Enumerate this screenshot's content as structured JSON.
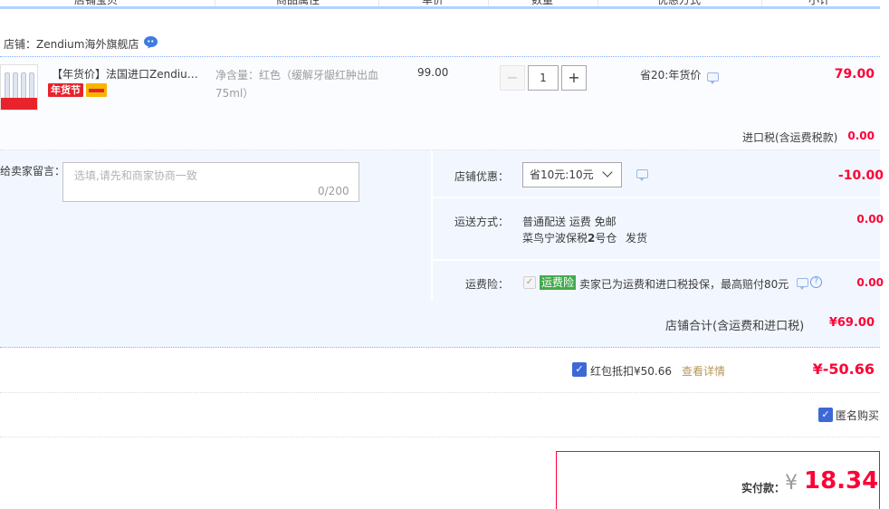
{
  "header": {
    "columns": [
      "店铺宝贝",
      "商品属性",
      "单价",
      "数量",
      "优惠方式",
      "小计"
    ]
  },
  "store": {
    "name_label": "店铺：Zendium海外旗舰店"
  },
  "item": {
    "title": "【年货价】法国进口Zendium...",
    "badge": "年货节",
    "attr": "净含量：红色（缓解牙龈红肿出血75ml）",
    "price": "99.00",
    "quantity": "1",
    "minus": "−",
    "plus": "+",
    "promo": "省20:年货价",
    "subtotal": "79.00"
  },
  "tax": {
    "label": "进口税(含运费税款)",
    "value": "0.00"
  },
  "message": {
    "label": "给卖家留言：",
    "placeholder": "选填,请先和商家协商一致",
    "count": "0/200"
  },
  "store_discount": {
    "label": "店铺优惠：",
    "selected": "省10元:10元",
    "value": "-10.00"
  },
  "shipping": {
    "label": "运送方式：",
    "method": "普通配送 运费 免邮",
    "warehouse_prefix": "菜鸟宁波保税",
    "warehouse_bold": "2",
    "warehouse_suffix": "号仓",
    "action": "发货",
    "value": "0.00"
  },
  "insurance": {
    "label": "运费险：",
    "badge": "运费险",
    "text": "卖家已为运费和进口税投保，最高赔付80元",
    "help": "?",
    "value": "0.00"
  },
  "store_total": {
    "label": "店铺合计(含运费和进口税)",
    "value": "¥69.00"
  },
  "coupon": {
    "label": "红包抵扣¥50.66",
    "link": "查看详情",
    "value": "¥-50.66"
  },
  "anonymous": {
    "label": "匿名购买"
  },
  "payment": {
    "label": "实付款：",
    "currency": "¥",
    "value": "18.34"
  },
  "colors": {
    "accent_red": "#ff0036",
    "accent_blue": "#3d69d6",
    "panel_bg": "#f2f7ff",
    "insurance_green": "#44aa4f"
  }
}
